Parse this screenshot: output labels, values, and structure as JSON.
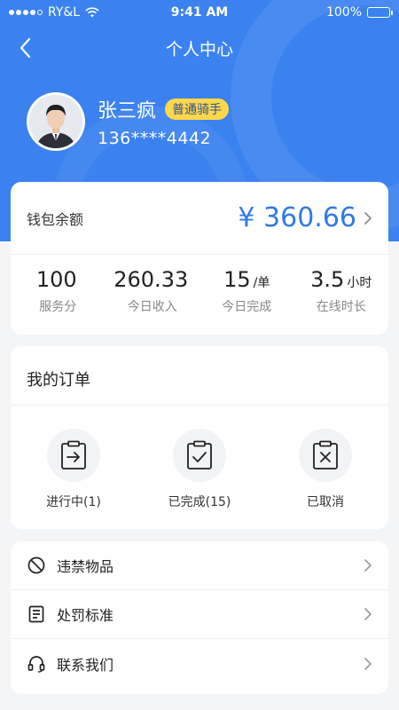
{
  "status_bar": {
    "carrier": "RY&L",
    "time": "9:41 AM",
    "battery": "100%"
  },
  "nav": {
    "title": "个人中心",
    "back_icon": "chevron-left-icon"
  },
  "profile": {
    "name": "张三疯",
    "badge": "普通骑手",
    "phone": "136****4442"
  },
  "wallet": {
    "label": "钱包余额",
    "amount": "¥ 360.66"
  },
  "stats": [
    {
      "value": "100",
      "unit": "",
      "label": "服务分"
    },
    {
      "value": "260.33",
      "unit": "",
      "label": "今日收入"
    },
    {
      "value": "15",
      "unit": "/单",
      "label": "今日完成"
    },
    {
      "value": "3.5",
      "unit": "小时",
      "label": "在线时长"
    }
  ],
  "orders": {
    "title": "我的订单",
    "items": [
      {
        "label": "进行中(1)",
        "icon": "clipboard-arrow-icon"
      },
      {
        "label": "已完成(15)",
        "icon": "clipboard-check-icon"
      },
      {
        "label": "已取消",
        "icon": "clipboard-x-icon"
      }
    ]
  },
  "menu": [
    {
      "label": "违禁物品",
      "icon": "prohibited-icon"
    },
    {
      "label": "处罚标准",
      "icon": "document-icon"
    },
    {
      "label": "联系我们",
      "icon": "headset-icon"
    }
  ],
  "colors": {
    "primary": "#3b82f0",
    "amount": "#2f7ae5",
    "badge": "#ffd84a"
  }
}
